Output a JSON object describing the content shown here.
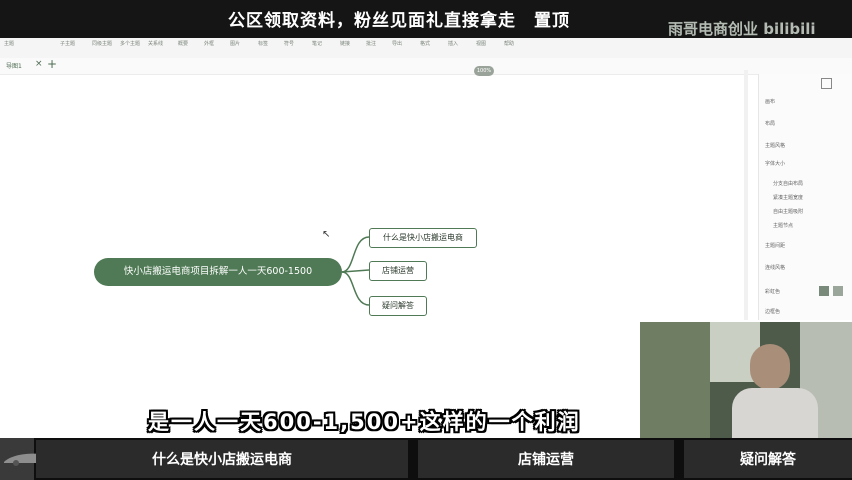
{
  "banner": {
    "text": "公区领取资料，粉丝见面礼直接拿走　置顶",
    "logo": "雨哥电商创业 bilibili"
  },
  "toolbar": {
    "items": [
      "主题",
      "子主题",
      "同级主题",
      "多个主题",
      "关系线",
      "概要",
      "外框",
      "图片",
      "标签",
      "符号",
      "笔记",
      "链接",
      "批注",
      "导出",
      "格式",
      "插入",
      "视图",
      "帮助"
    ]
  },
  "tab": {
    "name": "导图1",
    "close": "×",
    "add": "+"
  },
  "zoom": {
    "label": "100%"
  },
  "right_panel": {
    "labels": [
      "画布",
      "布局",
      "主题风格",
      "字体大小",
      "分支自由布局",
      "紧凑主题宽度",
      "自由主题吸附",
      "主题节点",
      "主题间距",
      "连线风格",
      "彩虹色",
      "边框色"
    ]
  },
  "mindmap": {
    "root": "快小店搬运电商项目拆解一人一天600-1500",
    "children": [
      "什么是快小店搬运电商",
      "店铺运营",
      "疑问解答"
    ]
  },
  "subtitle": "是一人一天600-1,500+这样的一个利润",
  "bottom_bar": {
    "segments": [
      "什么是快小店搬运电商",
      "店铺运营",
      "疑问解答"
    ]
  },
  "colors": {
    "accent": "#4f7a55",
    "banner_bg": "#151515",
    "bottom_bg": "#0e0e0e"
  }
}
